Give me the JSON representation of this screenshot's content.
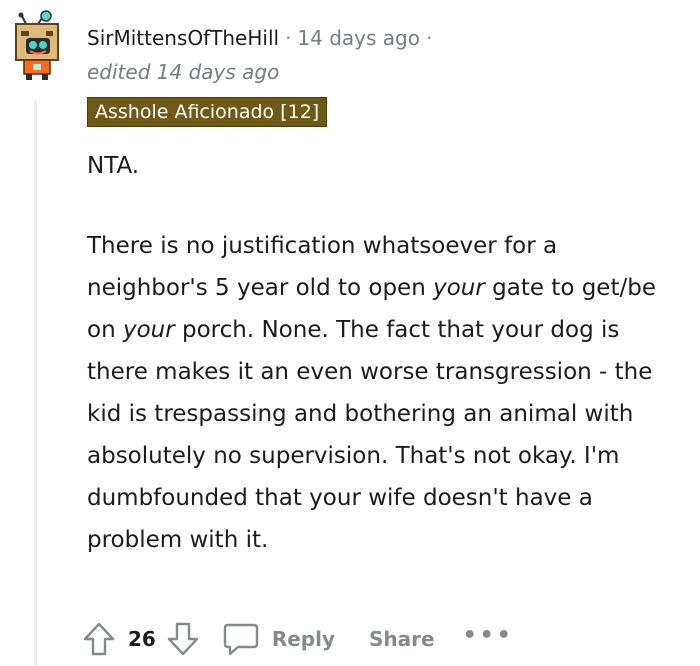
{
  "comment": {
    "username": "SirMittensOfTheHill",
    "separator": "·",
    "timestamp": "14 days ago",
    "trailing_separator": "·",
    "edited_text": "edited 14 days ago",
    "flair": "Asshole Aficionado [12]",
    "avatar_icon": "robot-cat-avatar-icon",
    "body": {
      "p1": "NTA.",
      "p2": {
        "s1": "There is no justification whatsoever for a neighbor's 5 year old to open ",
        "e1": "your",
        "s2": " gate to get/be on ",
        "e2": "your",
        "s3": " porch. None. The fact that your dog is there makes it an even worse transgression - the kid is trespassing and bothering an animal with absolutely no supervision. That's not okay. I'm dumbfounded that your wife doesn't have a problem with it."
      }
    },
    "actions": {
      "upvote_icon": "upvote-arrow-icon",
      "score": "26",
      "downvote_icon": "downvote-arrow-icon",
      "reply_icon": "speech-bubble-icon",
      "reply_label": "Reply",
      "share_label": "Share",
      "more_label": "•••"
    }
  },
  "colors": {
    "flair_bg": "#6e5a16",
    "meta_gray": "#787c7e",
    "action_gray": "#878a8c",
    "thread_line": "#edeff1"
  }
}
